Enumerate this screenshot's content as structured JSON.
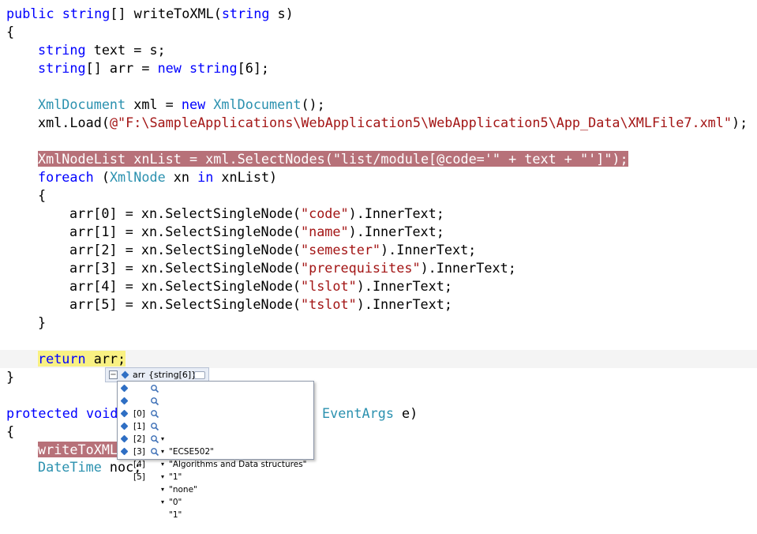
{
  "code": {
    "lines": [
      "public string[] writeToXML(string s)",
      "{",
      "string text = s;",
      "string[] arr = new string[6];",
      "",
      "XmlDocument xml = new XmlDocument();",
      "xml.Load(@\"F:\\SampleApplications\\WebApplication5\\WebApplication5\\App_Data\\XMLFile7.xml\");",
      "",
      "XmlNodeList xnList = xml.SelectNodes(\"list/module[@code='\" + text + \"']\");",
      "foreach (XmlNode xn in xnList)",
      "{",
      "arr[0] = xn.SelectSingleNode(\"code\").InnerText;",
      "arr[1] = xn.SelectSingleNode(\"name\").InnerText;",
      "arr[2] = xn.SelectSingleNode(\"semester\").InnerText;",
      "arr[3] = xn.SelectSingleNode(\"prerequisites\").InnerText;",
      "arr[4] = xn.SelectSingleNode(\"lslot\").InnerText;",
      "arr[5] = xn.SelectSingleNode(\"tslot\").InnerText;",
      "}",
      "",
      "return arr;",
      "}",
      "",
      "protected void",
      "{",
      "writeToXML",
      "DateTime noc;"
    ],
    "fragments": {
      "protected_tail": "EventArgs e)",
      "protected_tail_type": "EventArgs",
      "protected_tail_rest": " e)"
    },
    "colors": {
      "keyword": "#0000ff",
      "type": "#2b91af",
      "string": "#a31515",
      "error_highlight": "#b77179",
      "current_statement": "#f9f183"
    }
  },
  "datatip": {
    "var_name": "arr",
    "var_type": "{string[6]}",
    "items": [
      {
        "index": "[0]",
        "value": "\"ECSE502\""
      },
      {
        "index": "[1]",
        "value": "\"Algorithms and Data structures\""
      },
      {
        "index": "[2]",
        "value": "\"1\""
      },
      {
        "index": "[3]",
        "value": "\"none\""
      },
      {
        "index": "[4]",
        "value": "\"0\""
      },
      {
        "index": "[5]",
        "value": "\"1\""
      }
    ],
    "icons": {
      "expand": "minus-icon",
      "field": "field-gem-icon",
      "visualizer": "magnifier-icon",
      "dropdown": "dropdown-arrow-icon",
      "pin": "pin-icon"
    }
  }
}
